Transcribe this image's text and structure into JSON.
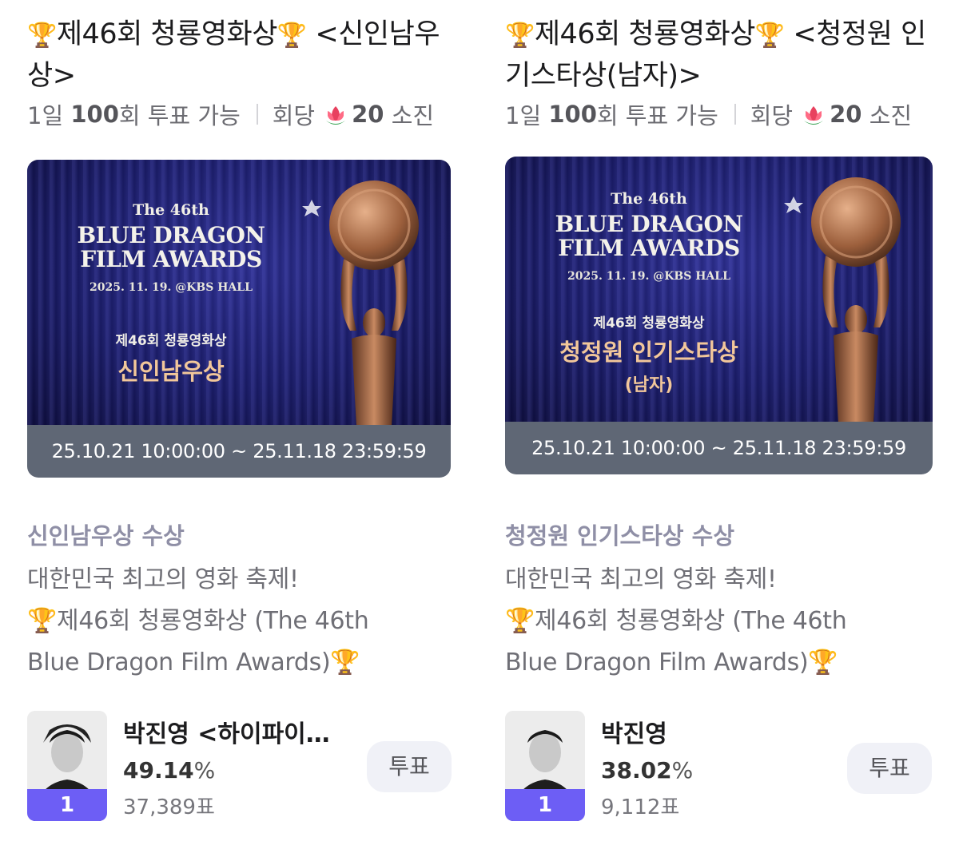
{
  "cards": [
    {
      "title_trophy_1": "🏆",
      "title_main": "제46회 청룡영화상",
      "title_trophy_2": "🏆",
      "title_suffix": " <신인남우상>",
      "meta_day": "1일",
      "meta_count": "100",
      "meta_count_suffix": "회 투표 가능",
      "meta_cost_label": "회당",
      "meta_cost": "20",
      "meta_cost_suffix": "소진",
      "banner_the": "The 46th",
      "banner_line1": "BLUE DRAGON",
      "banner_line2": "FILM AWARDS",
      "banner_date": "2025. 11. 19. @KBS HALL",
      "banner_kr": "제46회 청룡영화상",
      "banner_award": "신인남우상",
      "banner_sub": "",
      "period": "25.10.21 10:00:00 ~ 25.11.18 23:59:59",
      "section_title": "신인남우상 수상",
      "desc_line1": "대한민국 최고의 영화 축제!",
      "desc_line2": "🏆제46회 청룡영화상 (The 46th",
      "desc_line3": "Blue Dragon Film Awards)🏆",
      "candidate_name": "박진영 <하이파이…",
      "candidate_percent": "49.14",
      "percent_unit": "%",
      "candidate_votes": "37,389표",
      "rank": "1",
      "vote_label": "투표"
    },
    {
      "title_trophy_1": "🏆",
      "title_main": "제46회 청룡영화상",
      "title_trophy_2": "🏆",
      "title_suffix": " <청정원 인기스타상(남자)>",
      "meta_day": "1일",
      "meta_count": "100",
      "meta_count_suffix": "회 투표 가능",
      "meta_cost_label": "회당",
      "meta_cost": "20",
      "meta_cost_suffix": "소진",
      "banner_the": "The 46th",
      "banner_line1": "BLUE DRAGON",
      "banner_line2": "FILM AWARDS",
      "banner_date": "2025. 11. 19. @KBS HALL",
      "banner_kr": "제46회 청룡영화상",
      "banner_award": "청정원 인기스타상",
      "banner_sub": "(남자)",
      "period": "25.10.21 10:00:00 ~ 25.11.18 23:59:59",
      "section_title": "청정원 인기스타상 수상",
      "desc_line1": "대한민국 최고의 영화 축제!",
      "desc_line2": "🏆제46회 청룡영화상 (The 46th",
      "desc_line3": "Blue Dragon Film Awards)🏆",
      "candidate_name": "박진영",
      "candidate_percent": "38.02",
      "percent_unit": "%",
      "candidate_votes": "9,112표",
      "rank": "1",
      "vote_label": "투표"
    }
  ],
  "colors": {
    "rank_badge": "#6d5ef5",
    "period_bar": "#5f6775",
    "section_title": "#8f8fa6",
    "vote_button_bg": "#f0f1f7"
  },
  "icons": [
    "trophy-icon",
    "lotus-flower-icon",
    "trophy-statue-image",
    "profile-photo"
  ]
}
